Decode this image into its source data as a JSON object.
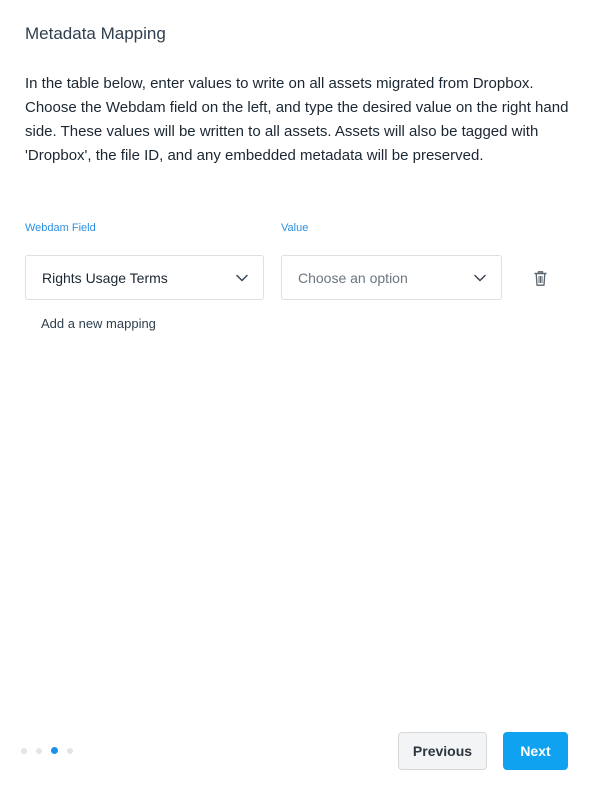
{
  "page": {
    "title": "Metadata Mapping",
    "description": "In the table below, enter values to write on all assets migrated from Dropbox. Choose the Webdam field on the left, and type the desired value on the right hand side. These values will be written to all assets. Assets will also be tagged with 'Dropbox', the file ID, and any embedded metadata will be preserved."
  },
  "mapping": {
    "field_label": "Webdam Field",
    "value_label": "Value",
    "rows": [
      {
        "field": "Rights Usage Terms",
        "value_placeholder": "Choose an option"
      }
    ],
    "add_link": "Add a new mapping"
  },
  "footer": {
    "steps_total": 4,
    "current_step": 3,
    "previous_label": "Previous",
    "next_label": "Next"
  },
  "colors": {
    "accent": "#0ea2f0",
    "label_blue": "#2d8fe0",
    "active_dot": "#1a91e6"
  },
  "icons": {
    "select_arrow": "chevron-down-icon",
    "delete": "trash-icon"
  }
}
